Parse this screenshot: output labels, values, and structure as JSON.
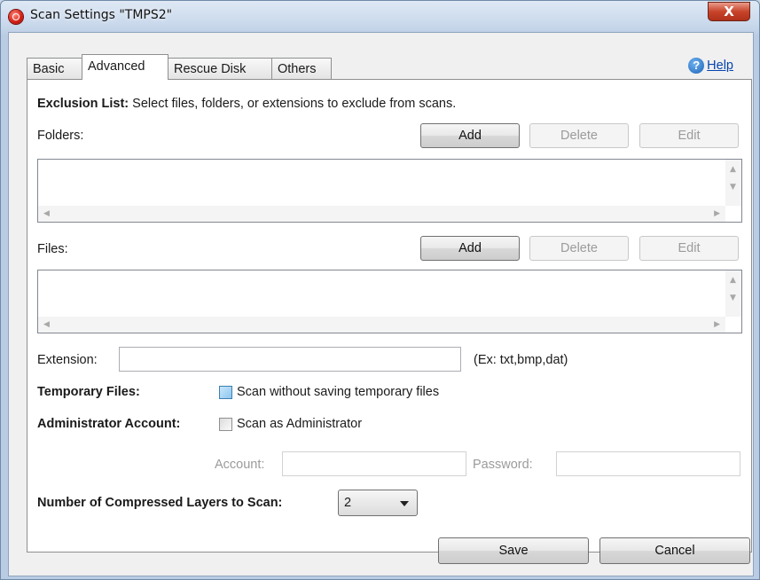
{
  "window": {
    "title": "Scan Settings \"TMPS2\"",
    "close_symbol": "X"
  },
  "tabs": [
    {
      "label": "Basic"
    },
    {
      "label": "Advanced",
      "active": true
    },
    {
      "label": "Rescue Disk"
    },
    {
      "label": "Others"
    }
  ],
  "help": {
    "label": "Help",
    "icon": "?"
  },
  "exclusion": {
    "heading": "Exclusion List:",
    "description": "Select files, folders, or extensions to exclude from scans.",
    "folders": {
      "label": "Folders:",
      "add": "Add",
      "delete": "Delete",
      "edit": "Edit"
    },
    "files": {
      "label": "Files:",
      "add": "Add",
      "delete": "Delete",
      "edit": "Edit"
    },
    "extension": {
      "label": "Extension:",
      "value": "",
      "hint": "(Ex: txt,bmp,dat)"
    }
  },
  "scroll_arrows": {
    "up": "▲",
    "down": "▼",
    "left": "◀",
    "right": "▶"
  },
  "temporary_files": {
    "label": "Temporary Files:",
    "option": "Scan without saving temporary files",
    "checked": false
  },
  "administrator": {
    "label": "Administrator Account:",
    "option": "Scan as Administrator",
    "checked": false,
    "account_label": "Account:",
    "account_value": "",
    "password_label": "Password:",
    "password_value": ""
  },
  "compressed_layers": {
    "label": "Number of Compressed Layers to Scan:",
    "value": "2"
  },
  "footer": {
    "save": "Save",
    "cancel": "Cancel"
  }
}
